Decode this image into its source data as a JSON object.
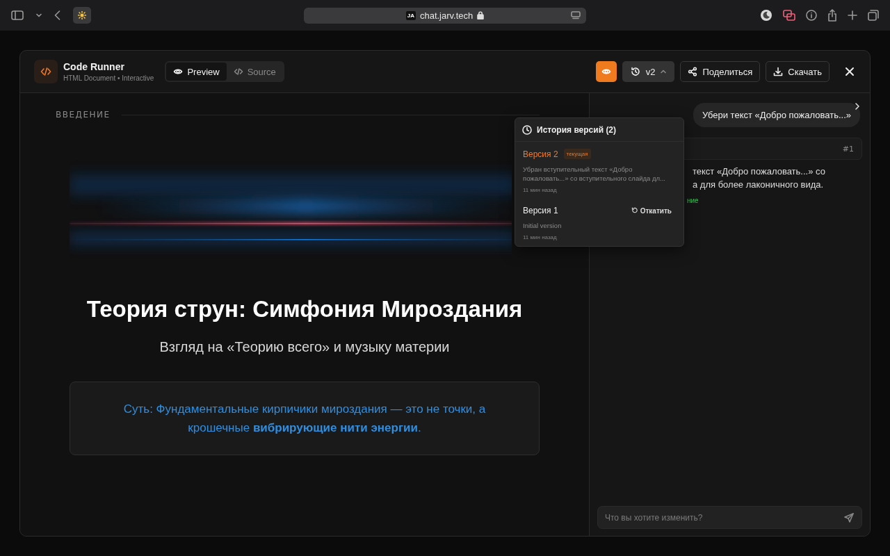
{
  "browser": {
    "site_badge": "JA",
    "url": "chat.jarv.tech"
  },
  "app": {
    "title": "Code Runner",
    "subtitle": "HTML Document • Interactive",
    "view_tabs": [
      {
        "label": "Preview",
        "kind": "eye",
        "selected": true
      },
      {
        "label": "Source",
        "kind": "code",
        "selected": false
      }
    ],
    "preview_toggle": {
      "on": true
    },
    "version_button": {
      "label": "v2",
      "expanded": true
    },
    "buttons": [
      {
        "label": "Поделиться",
        "kind": "share"
      },
      {
        "label": "Скачать",
        "kind": "download"
      }
    ]
  },
  "version_history": {
    "title": "История версий (2)",
    "versions": [
      {
        "name": "Версия 2",
        "current": true,
        "badge": "текущая",
        "description": "Убран вступительный текст «Добро пожаловать...» со вступительного слайда дл...",
        "time": "11 мин назад"
      },
      {
        "name": "Версия 1",
        "current": false,
        "action": "Откатить",
        "description": "Initial version",
        "time": "11 мин назад"
      }
    ]
  },
  "preview": {
    "section_label": "ВВЕДЕНИЕ",
    "title": "Теория струн: Симфония Мироздания",
    "subtitle": "Взгляд на «Теорию всего» и музыку материи",
    "callout": "Суть: Фундаментальные кирпичики мироздания — это не точки, а крошечные **вибрирующие нити энергии**."
  },
  "chat": {
    "user_message": "Убери текст «Добро пожаловать...»",
    "response_number": "#1",
    "response_lines": [
      "текст «Добро пожаловать...» со",
      "а для более лаконичного вида."
    ],
    "status_fragment": "ние",
    "input_placeholder": "Что вы хотите изменить?"
  }
}
